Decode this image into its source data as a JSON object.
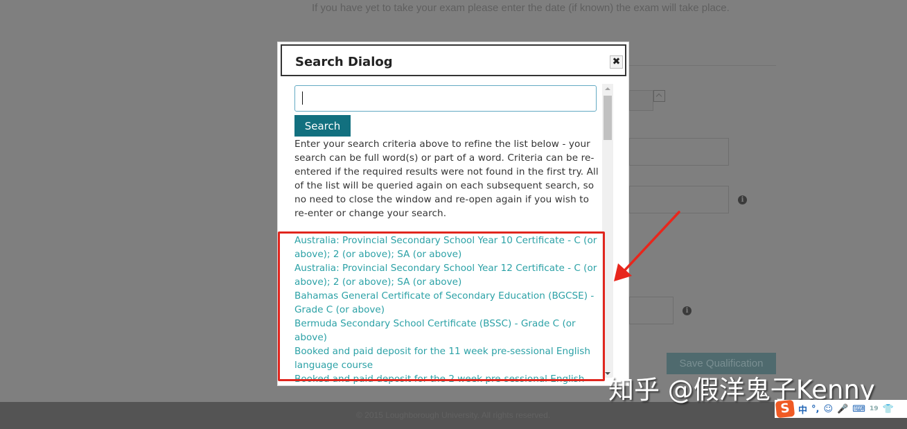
{
  "background": {
    "instruction": "If you have yet to take your exam please enter the date (if known) the exam will take place.",
    "save_button": "Save Qualification",
    "info_icon_glyph": "i",
    "footer": "© 2015 Loughborough University. All rights reserved."
  },
  "dialog": {
    "title": "Search Dialog",
    "close_glyph": "✖",
    "search_input": {
      "value": "",
      "placeholder": ""
    },
    "search_button": "Search",
    "instructions": "Enter your search criteria above to refine the list below - your search can be full word(s) or part of a word. Criteria can be re-entered if the required results were not found in the first try. All of the list will be queried again on each subsequent search, so no need to close the window and re-open again if you wish to re-enter or change your search.",
    "results": [
      "Australia: Provincial Secondary School Year 10 Certificate - C (or above); 2 (or above); SA (or above)",
      "Australia: Provincial Secondary School Year 12 Certificate - C (or above); 2 (or above); SA (or above)",
      "Bahamas General Certificate of Secondary Education (BGCSE) - Grade C (or above)",
      "Bermuda Secondary School Certificate (BSSC) - Grade C (or above)",
      "Booked and paid deposit for the 11 week pre-sessional English language course",
      "Booked and paid deposit for the 2 week pre-sessional English"
    ]
  },
  "annotations": {
    "highlight_color": "#e0261e",
    "watermark": "知乎 @假洋鬼子Kenny"
  },
  "ime_toolbar": {
    "logo": "S",
    "items": [
      "中",
      "°,",
      "☺",
      "🎤",
      "⌨",
      "19",
      "👕"
    ]
  },
  "colors": {
    "overlay": "#7f7f7f",
    "footer": "#545454",
    "search_button": "#12707f",
    "result_link": "#2ba1a6",
    "input_border": "#62a9c3"
  }
}
